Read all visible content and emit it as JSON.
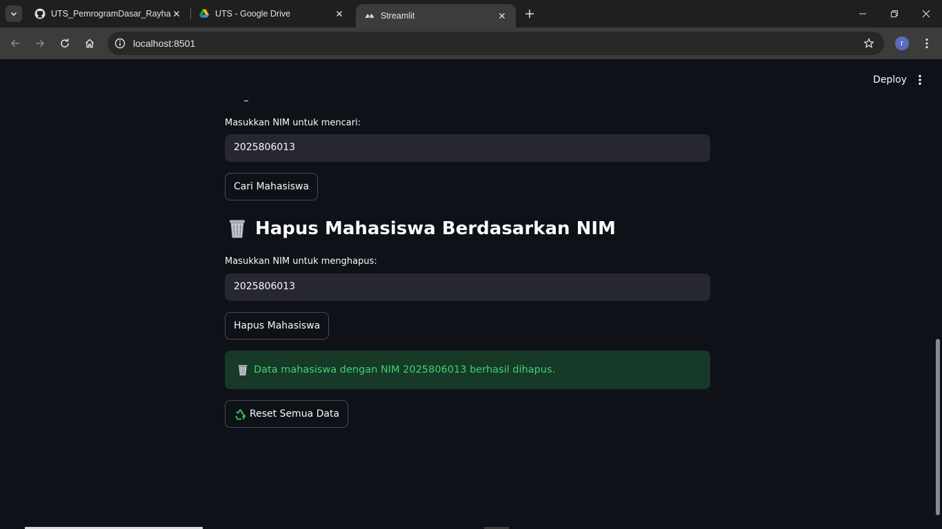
{
  "browser": {
    "tabs": [
      {
        "title": "UTS_PemrogramDasar_Rayhan",
        "favicon": "github-icon",
        "active": false
      },
      {
        "title": "UTS - Google Drive",
        "favicon": "google-drive-icon",
        "active": false
      },
      {
        "title": "Streamlit",
        "favicon": "streamlit-icon",
        "active": true
      }
    ],
    "url": "localhost:8501",
    "profile_initial": "r"
  },
  "app": {
    "header": {
      "deploy_label": "Deploy"
    },
    "search": {
      "label": "Masukkan NIM untuk mencari:",
      "value": "2025806013",
      "button_label": "Cari Mahasiswa"
    },
    "delete": {
      "heading": "Hapus Mahasiswa Berdasarkan NIM",
      "heading_icon": "wastebasket-icon",
      "label": "Masukkan NIM untuk menghapus:",
      "value": "2025806013",
      "button_label": "Hapus Mahasiswa"
    },
    "success_message": {
      "icon": "wastebasket-icon",
      "text": "Data mahasiswa dengan NIM 2025806013 berhasil dihapus."
    },
    "reset": {
      "icon": "recycle-icon",
      "button_label": "Reset Semua Data"
    }
  },
  "colors": {
    "background": "#0e1117",
    "input_bg": "#262730",
    "success_bg": "#173928",
    "success_text": "#3dd56d"
  }
}
